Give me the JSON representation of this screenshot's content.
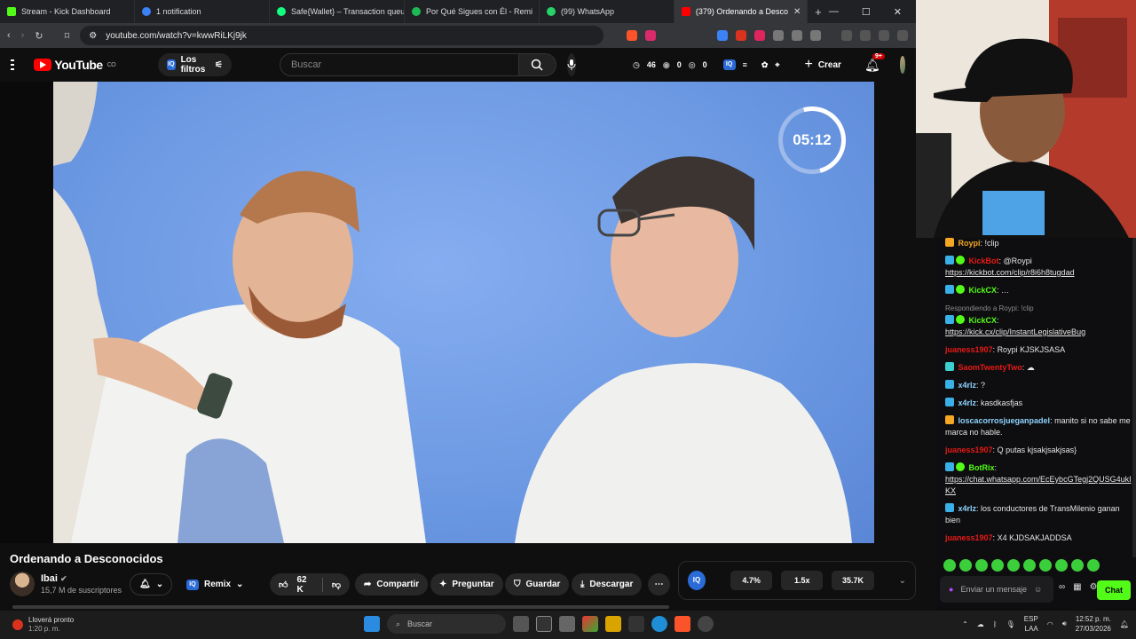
{
  "browser": {
    "tabs": [
      {
        "label": "Stream - Kick Dashboard",
        "color": "#53fc18"
      },
      {
        "label": "1 notification",
        "color": "#3b82f6"
      },
      {
        "label": "Safe{Wallet} – Transaction queue",
        "color": "#12ff80"
      },
      {
        "label": "Por Qué Sigues con Él - Remi",
        "color": "#1db954"
      },
      {
        "label": "(99) WhatsApp",
        "color": "#25d366"
      },
      {
        "label": "(379) Ordenando a Desco",
        "color": "#ff0000"
      }
    ],
    "url": "youtube.com/watch?v=kwwRiLKj9jk"
  },
  "youtube": {
    "logo_text": "YouTube",
    "logo_country": "CO",
    "filters_label": "Los filtros",
    "search_placeholder": "Buscar",
    "stats": {
      "a": "46",
      "b": "0",
      "c": "0"
    },
    "create_label": "Crear",
    "notif_count": "9+",
    "timer": "05:12",
    "video_title": "Ordenando a Desconocidos",
    "channel_name": "Ibai",
    "channel_subs": "15,7 M de suscriptores",
    "remix_label": "Remix",
    "likes": "62 K",
    "share_label": "Compartir",
    "ask_label": "Preguntar",
    "save_label": "Guardar",
    "download_label": "Descargar",
    "panel": {
      "v1": "4.7%",
      "v2": "1.5x",
      "v3": "35.7K"
    }
  },
  "chat": {
    "messages": [
      {
        "user": "Roypi",
        "color": "#f5a623",
        "text": "!clip",
        "badge": "#f5a623"
      },
      {
        "user": "KickBot",
        "color": "#e91916",
        "text": "@Roypi",
        "link": "https://kickbot.com/clip/r8i6h8tugdad",
        "badge": "#53fc18"
      },
      {
        "user": "KickCX",
        "color": "#53fc18",
        "text": "…",
        "badge": "#53fc18"
      },
      {
        "reply": "Respondiendo a Roypi: !clip",
        "user": "KickCX",
        "color": "#53fc18",
        "text": "",
        "link": "https://kick.cx/clip/InstantLegislativeBug",
        "badge": "#53fc18"
      },
      {
        "user": "juaness1907",
        "color": "#e91916",
        "text": "Roypi KJSKJSASA"
      },
      {
        "user": "SaomTwentyTwo",
        "color": "#e91916",
        "text": "",
        "badge": "#3ccfcf"
      },
      {
        "user": "x4rlz",
        "color": "#8fd3ff",
        "text": "?",
        "badge": "#3ab0e8"
      },
      {
        "user": "x4rlz",
        "color": "#8fd3ff",
        "text": "kasdkasfjas",
        "badge": "#3ab0e8"
      },
      {
        "user": "loscacorrosjueganpadel",
        "color": "#8fd3ff",
        "text": "manito si no sabe me marca no hable.",
        "badge": "#f5a623"
      },
      {
        "user": "juaness1907",
        "color": "#e91916",
        "text": "Q putas kjsakjsakjsas}"
      },
      {
        "user": "BotRix",
        "color": "#53fc18",
        "text": "",
        "link": "https://chat.whatsapp.com/EcEybcGTegj2QUSG4ukIKX",
        "badge": "#53fc18"
      },
      {
        "user": "x4rlz",
        "color": "#8fd3ff",
        "text": "los conductores de TransMilenio ganan bien",
        "badge": "#3ab0e8"
      },
      {
        "user": "juaness1907",
        "color": "#e91916",
        "text": "X4 KJDSAKJADDSA"
      }
    ],
    "input_placeholder": "Enviar un mensaje",
    "send_label": "Chat"
  },
  "taskbar": {
    "weather_title": "Lloverá pronto",
    "weather_time": "1:20 p. m.",
    "search_label": "Buscar",
    "lang1": "ESP",
    "lang2": "LAA",
    "time": "12:52 p. m.",
    "date": "27/03/2026"
  }
}
